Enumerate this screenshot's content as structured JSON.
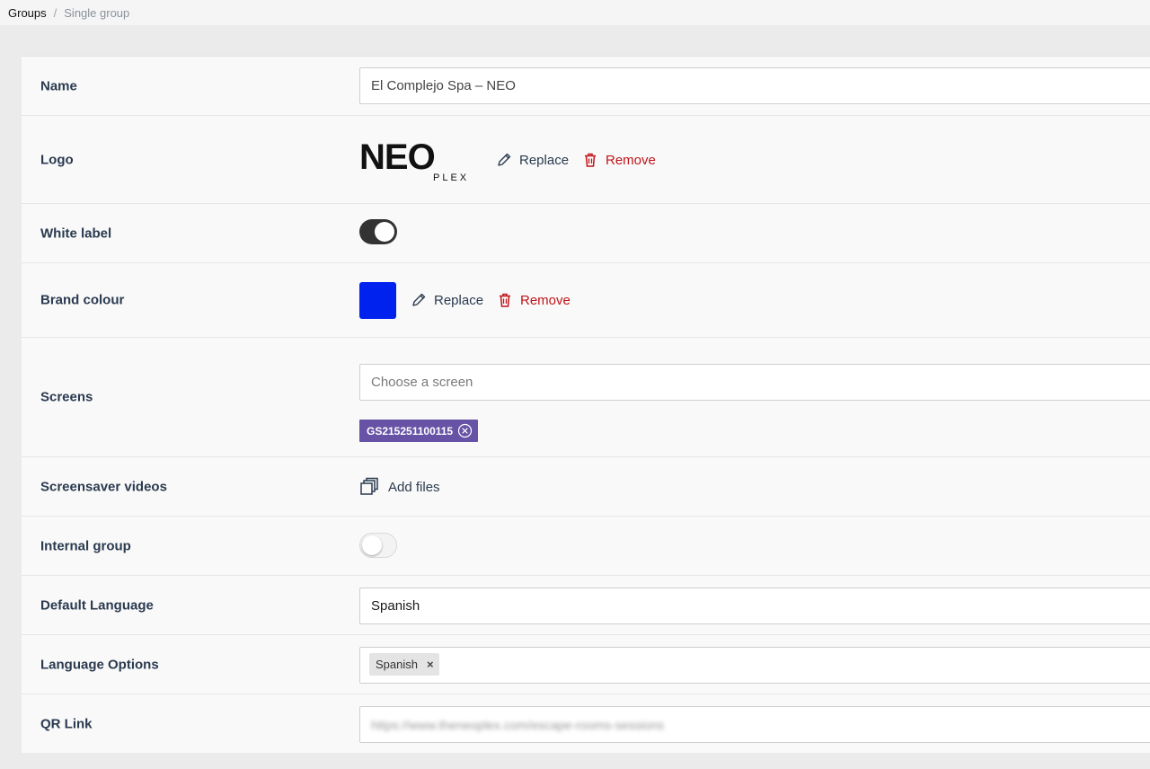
{
  "breadcrumb": {
    "root": "Groups",
    "separator": "/",
    "current": "Single group"
  },
  "fields": {
    "name": {
      "label": "Name",
      "value": "El Complejo Spa – NEO"
    },
    "logo": {
      "label": "Logo",
      "brand_text": "NEO",
      "brand_sub": "PLEX",
      "replace": "Replace",
      "remove": "Remove"
    },
    "white_label": {
      "label": "White label",
      "enabled": true
    },
    "brand_colour": {
      "label": "Brand colour",
      "color": "#0022ee",
      "replace": "Replace",
      "remove": "Remove"
    },
    "screens": {
      "label": "Screens",
      "placeholder": "Choose a screen",
      "selected": [
        "GS215251100115"
      ]
    },
    "screensaver_videos": {
      "label": "Screensaver videos",
      "add_files": "Add files"
    },
    "internal_group": {
      "label": "Internal group",
      "enabled": false
    },
    "default_language": {
      "label": "Default Language",
      "value": "Spanish"
    },
    "language_options": {
      "label": "Language Options",
      "selected": [
        "Spanish"
      ],
      "remove_glyph": "×"
    },
    "qr_link": {
      "label": "QR Link",
      "value": "https://www.theneoplex.com/escape-rooms-sessions"
    }
  },
  "colors": {
    "accent_chip": "#6753a6",
    "danger": "#c0141a",
    "toggle_on": "#333333"
  }
}
